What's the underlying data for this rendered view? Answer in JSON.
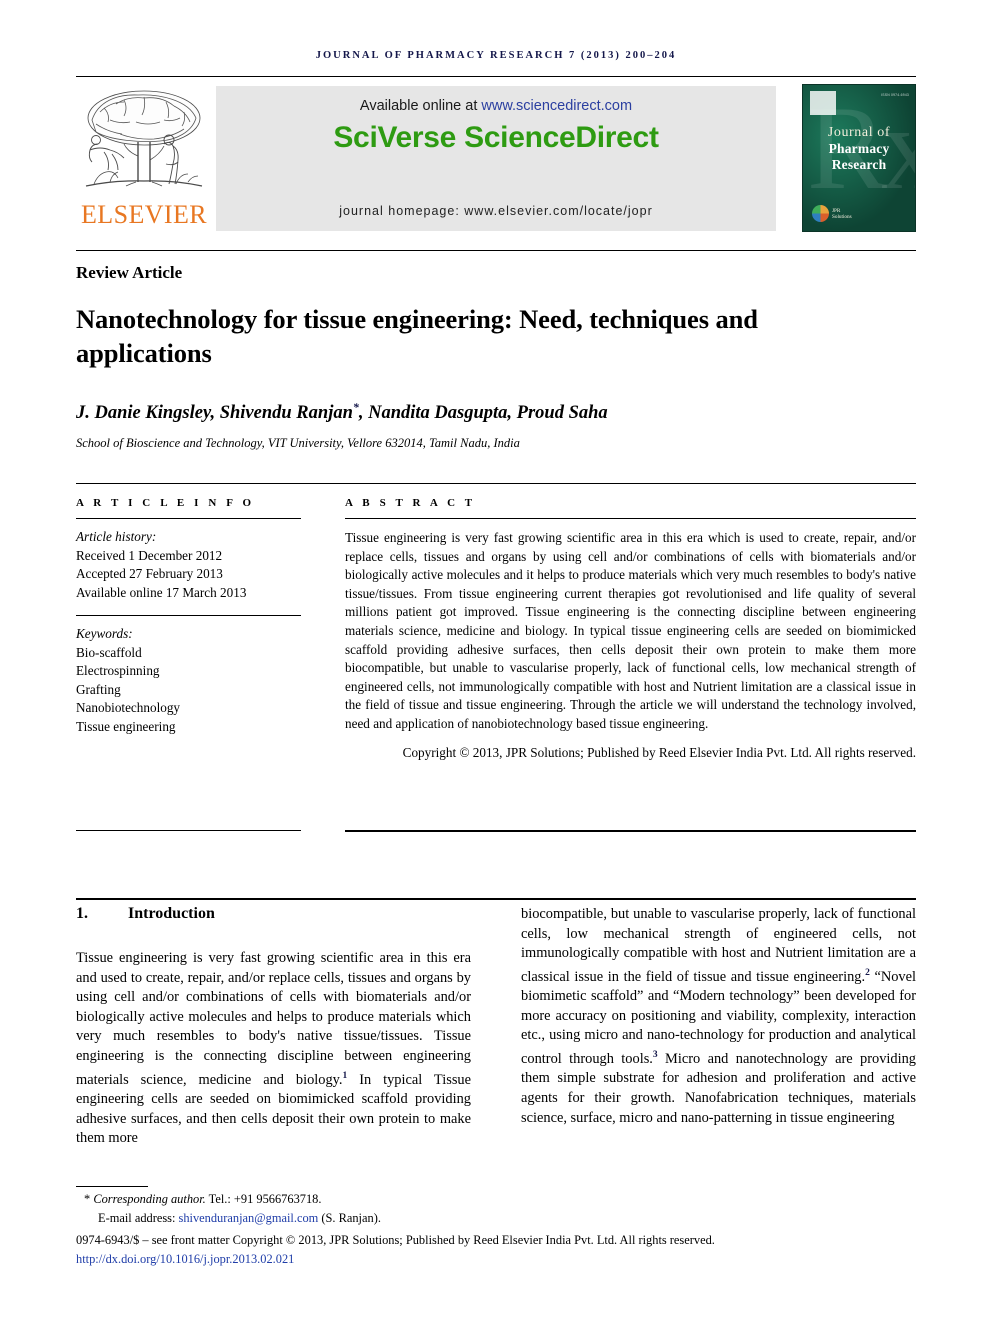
{
  "running_head": "Journal of Pharmacy Research 7 (2013) 200–204",
  "masthead": {
    "publisher_name": "ELSEVIER",
    "available_prefix": "Available online at ",
    "available_url": "www.sciencedirect.com",
    "sciencedirect_logo": "SciVerse ScienceDirect",
    "journal_homepage": "journal homepage: www.elsevier.com/locate/jopr",
    "cover": {
      "title_line1": "Journal of",
      "title_line2": "Pharmacy Research",
      "issn_text": "ISSN 0974-6943",
      "society_line1": "JPR",
      "society_line2": "Solutions",
      "watermark": "Rx"
    }
  },
  "article": {
    "type": "Review Article",
    "title": "Nanotechnology for tissue engineering: Need, techniques and applications",
    "authors": "J. Danie Kingsley, Shivendu Ranjan",
    "authors_after_star": ", Nandita Dasgupta, Proud Saha",
    "corresponding_marker": "*",
    "affiliation": "School of Bioscience and Technology, VIT University, Vellore 632014, Tamil Nadu, India"
  },
  "article_info": {
    "heading": "A R T I C L E   I N F O",
    "history_label": "Article history:",
    "received": "Received 1 December 2012",
    "accepted": "Accepted 27 February 2013",
    "available_online": "Available online 17 March 2013",
    "keywords_label": "Keywords:",
    "keywords": [
      "Bio-scaffold",
      "Electrospinning",
      "Grafting",
      "Nanobiotechnology",
      "Tissue engineering"
    ]
  },
  "abstract": {
    "heading": "A B S T R A C T",
    "body": "Tissue engineering is very fast growing scientific area in this era which is used to create, repair, and/or replace cells, tissues and organs by using cell and/or combinations of cells with biomaterials and/or biologically active molecules and it helps to produce materials which very much resembles to body's native tissue/tissues. From tissue engineering current therapies got revolutionised and life quality of several millions patient got improved. Tissue engineering is the connecting discipline between engineering materials science, medicine and biology. In typical tissue engineering cells are seeded on biomimicked scaffold providing adhesive surfaces, then cells deposit their own protein to make them more biocompatible, but unable to vascularise properly, lack of functional cells, low mechanical strength of engineered cells, not immunologically compatible with host and Nutrient limitation are a classical issue in the field of tissue and tissue engineering. Through the article we will understand the technology involved, need and application of nanobiotechnology based tissue engineering.",
    "copyright": "Copyright © 2013, JPR Solutions; Published by Reed Elsevier India Pvt. Ltd. All rights reserved."
  },
  "body": {
    "section_number": "1.",
    "section_title": "Introduction",
    "left_column_part1": "Tissue engineering is very fast growing scientific area in this era and used to create, repair, and/or replace cells, tissues and organs by using cell and/or combinations of cells with biomaterials and/or biologically active molecules and helps to produce materials which very much resembles to body's native tissue/tissues. Tissue engineering is the connecting discipline between engineering materials science, medicine and biology.",
    "left_ref1": "1",
    "left_column_part2": " In typical Tissue engineering cells are seeded on biomimicked scaffold providing adhesive surfaces, and then cells deposit their own protein to make them more",
    "right_column_part1": "biocompatible, but unable to vascularise properly, lack of functional cells, low mechanical strength of engineered cells, not immunologically compatible with host and Nutrient limitation are a classical issue in the field of tissue and tissue engineering.",
    "right_ref2": "2",
    "right_column_part2": " “Novel biomimetic scaffold” and “Modern technology” been developed for more accuracy on positioning and viability, complexity, interaction etc., using micro and nano-technology for production and analytical control through tools.",
    "right_ref3": "3",
    "right_column_part3": " Micro and nanotechnology are providing them simple substrate for adhesion and proliferation and active agents for their growth. Nanofabrication techniques, materials science, surface, micro and nano-patterning in tissue engineering"
  },
  "footer": {
    "corresponding_marker": "*",
    "corresponding_label": "Corresponding author.",
    "corresponding_tel": " Tel.: +91 9566763718.",
    "email_label": "E-mail address: ",
    "email": "shivenduranjan@gmail.com",
    "email_suffix": " (S. Ranjan).",
    "issn_copyright": "0974-6943/$ – see front matter Copyright © 2013, JPR Solutions; Published by Reed Elsevier India Pvt. Ltd. All rights reserved.",
    "doi": "http://dx.doi.org/10.1016/j.jopr.2013.02.021"
  },
  "colors": {
    "running_head": "#14174a",
    "elsevier_orange": "#e87722",
    "sciencedirect_green": "#2e9b12",
    "link_blue": "#1f3da8",
    "banner_grey": "#e6e6e6",
    "cover_green": "#145c46"
  }
}
